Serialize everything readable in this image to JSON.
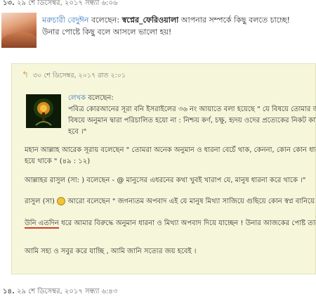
{
  "comment_13": {
    "number": "১৩.",
    "timestamp": "২৯ শে ডিসেম্বর, ২০১৭ সন্ধ্যা ৬:০৬"
  },
  "quote": {
    "author": "মরুচারী বেদুঈন",
    "said": "বলেছেন:",
    "target": "স্বপ্নের_ফেরিওয়ালা",
    "line1_rest": "আপনার সম্পর্কে কিছু বলতে চাচ্ছে!",
    "line2": "উনার পোষ্টে কিছু বলে আসলে ভালো হয়!"
  },
  "reply": {
    "arrow": "↰",
    "timestamp": "৩০ শে ডিসেম্বর, ২০১৭ রাত ২:০১",
    "author_role": "লেখক",
    "said": "বলেছেন:",
    "p1_l1": "পবিত্র কোরআনের সূরা বনি ইসরাইলের ৩৬ নং আয়াতে বলা হয়েছে \" যে বিষয়ে তোমার জান",
    "p1_l2": "বিষয়ে অনুমান দ্বারা পরিচালিত হয়ো না : নিশ্চয় কর্ণ, চক্ষু, হৃদয় ওদের প্রত্যেকের নিকট কাফি",
    "p1_l3": "হবে ।\"",
    "p2_l1": "মহান আল্লাহ আরেক সূরায় বলেছেন \" তোমরা অনেক অনুমান ও ধারনা বেচেঁ থাক, কেননা, কোন কোন ধারন",
    "p2_l2": "হয়ে থাকে \" (৪৯ : ১২)",
    "p3": "আল্লাহর রাসুল (সা: ) বলেছেন - @ মানুসের এধরনের কথা খুবই খারাপ যে, মানুষ ধারনা করে থাকে ।\"",
    "p4_a": "রাসুল (সা)",
    "p4_b": "আরো বলেছেন \" জগন্যতম অপবাদ এই যে মানুষ মিথ্যা সাজিয়ে গুছিয়ে কোন স্বপ্ন বানিয়ে নে",
    "p5_underlined": "উনি এতদিন",
    "p5_rest": " ধরে আমার বিরুদ্ধে অনুমান ধারনা ও মিথ্যা অপবাদ দিয়ে যাচ্ছেন ! উনার আজকের পোষ্ট তার ব",
    "p6": "আমি সহ্য ও সবুর করে যাচ্ছি , আমি জানি সত্যের জয় হবেই ।"
  },
  "comment_14": {
    "number": "১৪.",
    "timestamp": "২৯ শে ডিসেম্বর, ২০১৭ সন্ধ্যা ৬:৪৩"
  },
  "colors": {
    "link": "#3a7bbf",
    "reply_bg": "#f6f7da",
    "underline": "#d23a2a"
  }
}
